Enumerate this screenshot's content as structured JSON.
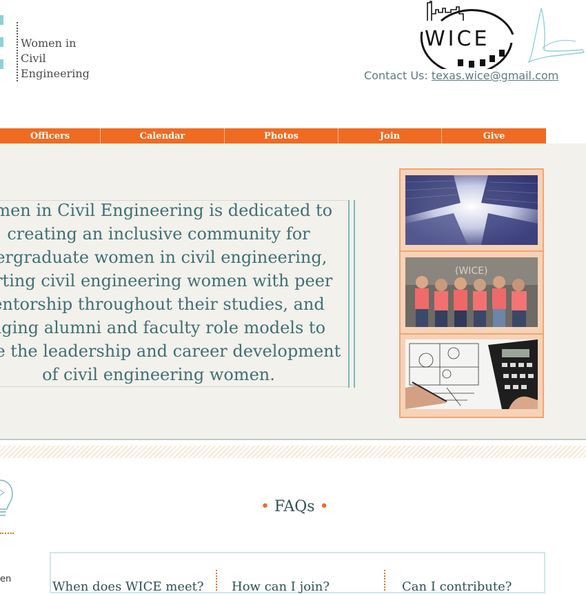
{
  "brand": {
    "line1": "Women in",
    "line2": "Civil",
    "line3": "Engineering",
    "logo_text": "WICE"
  },
  "contact": {
    "label": "Contact Us: ",
    "email": "texas.wice@gmail.com"
  },
  "nav": {
    "items": [
      "Officers",
      "Calendar",
      "Photos",
      "Join",
      "Give"
    ]
  },
  "hero": {
    "mission_lines": [
      "omen in Civil Engineering is dedicated to",
      "creating an inclusive community for",
      "lergraduate women in civil engineering,",
      "orting civil engineering women with peer",
      "entorship throughout their studies, and",
      "aging alumni and faculty role models to",
      "ace the leadership and career development",
      "of civil engineering women."
    ]
  },
  "faq": {
    "title": "FAQs",
    "questions": [
      "When does WICE meet?",
      "How can I join?",
      "Can I contribute?"
    ],
    "side_text": "en"
  },
  "colors": {
    "accent": "#ef6b22",
    "teal": "#3f6f74",
    "hero_bg": "#f2f1ec"
  }
}
